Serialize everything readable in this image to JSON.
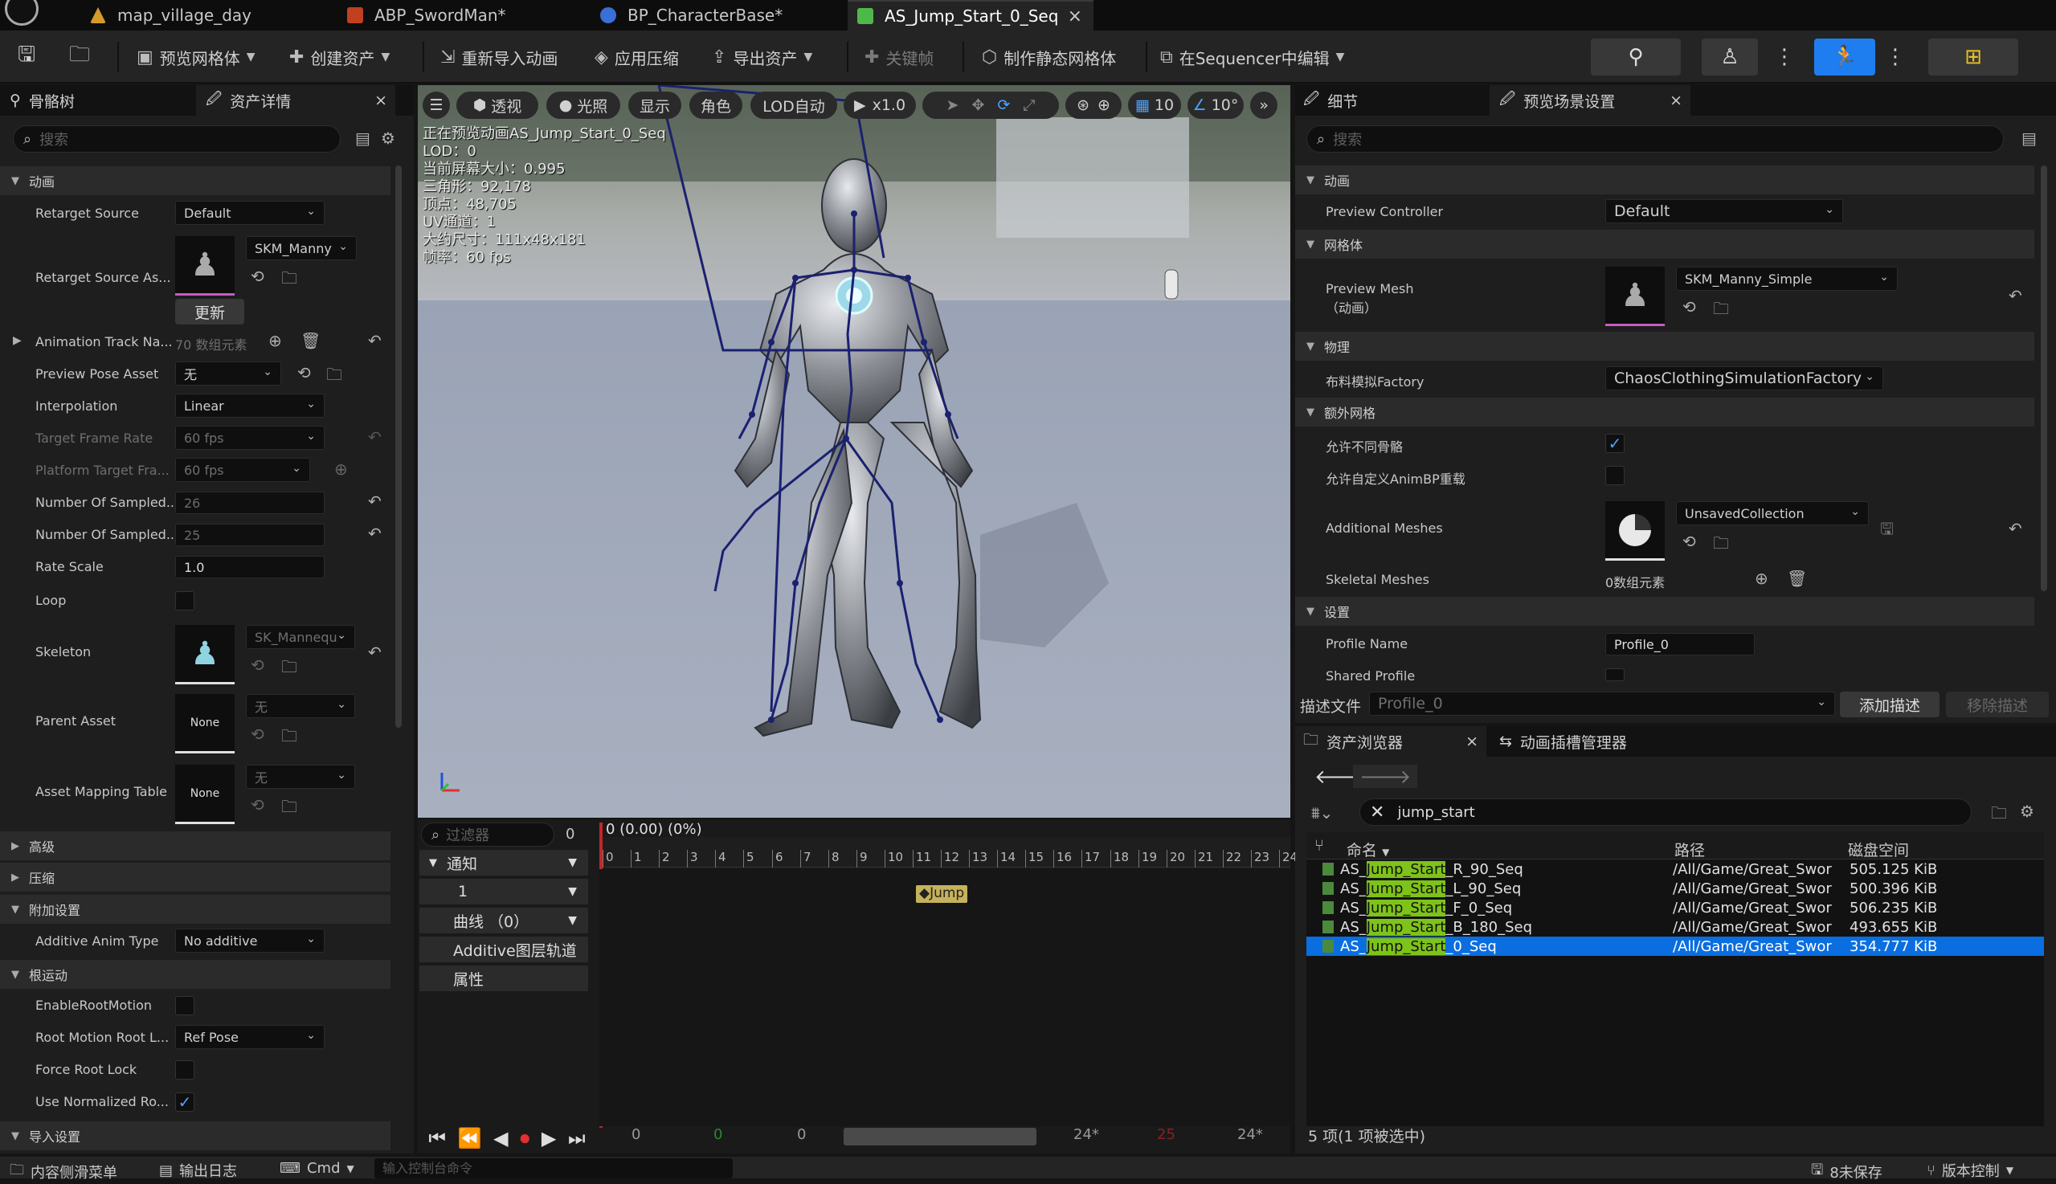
{
  "tabs": [
    {
      "label": "map_village_day",
      "icon": "map-icon",
      "color": "#d49a2a"
    },
    {
      "label": "ABP_SwordMan*",
      "icon": "anim-blueprint-icon",
      "color": "#c04020"
    },
    {
      "label": "BP_CharacterBase*",
      "icon": "blueprint-icon",
      "color": "#3a6fd6"
    },
    {
      "label": "AS_Jump_Start_0_Seq",
      "icon": "anim-sequence-icon",
      "color": "#4fb84a",
      "close": "×"
    }
  ],
  "toolbar": {
    "preview_mesh": "预览网格体",
    "create_asset": "创建资产",
    "reimport": "重新导入动画",
    "compression": "应用压缩",
    "export": "导出资产",
    "keyframe": "关键帧",
    "make_static_mesh": "制作静态网格体",
    "edit_in_sequencer": "在Sequencer中编辑"
  },
  "left_panel": {
    "tab_skeleton_tree": "骨骼树",
    "tab_asset_details": "资产详情",
    "close": "×",
    "search_placeholder": "搜索",
    "sections": {
      "animation": "动画",
      "advanced": "高级",
      "compression": "压缩",
      "additional_settings": "附加设置",
      "root_motion": "根运动",
      "import_settings": "导入设置"
    },
    "props": {
      "retarget_source": {
        "label": "Retarget Source",
        "value": "Default"
      },
      "retarget_source_asset": {
        "label": "Retarget Source As...",
        "value": "SKM_Manny",
        "update": "更新"
      },
      "animation_track_names": {
        "label": "Animation Track Na...",
        "value": "70 数组元素"
      },
      "preview_pose_asset": {
        "label": "Preview Pose Asset",
        "value": "无"
      },
      "interpolation": {
        "label": "Interpolation",
        "value": "Linear"
      },
      "target_frame_rate": {
        "label": "Target Frame Rate",
        "value": "60 fps"
      },
      "platform_target_frame_rate": {
        "label": "Platform Target Fra...",
        "value": "60 fps"
      },
      "number_sampled_keys": {
        "label": "Number Of Sampled...",
        "value": "26"
      },
      "number_sampled_frames": {
        "label": "Number Of Sampled...",
        "value": "25"
      },
      "rate_scale": {
        "label": "Rate Scale",
        "value": "1.0"
      },
      "loop": {
        "label": "Loop",
        "checked": false
      },
      "skeleton": {
        "label": "Skeleton",
        "value": "SK_Mannequ"
      },
      "parent_asset": {
        "label": "Parent Asset",
        "thumb": "None",
        "value": "无"
      },
      "asset_mapping_table": {
        "label": "Asset Mapping Table",
        "thumb": "None",
        "value": "无"
      },
      "additive_anim_type": {
        "label": "Additive Anim Type",
        "value": "No additive"
      },
      "enable_root_motion": {
        "label": "EnableRootMotion",
        "checked": false
      },
      "root_motion_root_lock": {
        "label": "Root Motion Root L...",
        "value": "Ref Pose"
      },
      "force_root_lock": {
        "label": "Force Root Lock",
        "checked": false
      },
      "use_normalized_root": {
        "label": "Use Normalized Ro...",
        "checked": true
      }
    }
  },
  "viewport": {
    "toolbar": {
      "perspective": "透视",
      "lit": "光照",
      "show": "显示",
      "character": "角色",
      "lod": "LOD自动",
      "play_rate": "x1.0",
      "grid_size": "10",
      "angle_snap": "10°"
    },
    "stats": [
      "正在预览动画AS_Jump_Start_0_Seq",
      "LOD：0",
      "当前屏幕大小：0.995",
      "三角形：92,178",
      "顶点：48,705",
      "UV通道：1",
      "大约尺寸：111x48x181",
      "帧率：60 fps"
    ]
  },
  "timeline": {
    "filter_placeholder": "过滤器",
    "filter_count": "0",
    "current_frame": "0 (0.00) (0%)",
    "tracks": [
      "通知",
      "1",
      "曲线 （0）",
      "Additive图层轨道",
      "属性"
    ],
    "ticks": [
      "0",
      "1",
      "2",
      "3",
      "4",
      "5",
      "6",
      "7",
      "8",
      "9",
      "10",
      "11",
      "12",
      "13",
      "14",
      "15",
      "16",
      "17",
      "18",
      "19",
      "20",
      "21",
      "22",
      "23",
      "24"
    ],
    "notify": "Jump",
    "bottom_numbers": [
      "0",
      "0",
      "0",
      "24*",
      "25",
      "24*"
    ]
  },
  "details": {
    "tab_details": "细节",
    "tab_preview_scene": "预览场景设置",
    "close": "×",
    "search_placeholder": "搜索",
    "sections": {
      "animation": "动画",
      "mesh": "网格体",
      "physics": "物理",
      "additional_meshes": "额外网格",
      "settings": "设置"
    },
    "preview_controller": {
      "label": "Preview Controller",
      "value": "Default"
    },
    "preview_mesh": {
      "label": "Preview Mesh",
      "sublabel": "（动画）",
      "value": "SKM_Manny_Simple"
    },
    "clothing_factory": {
      "label": "布料模拟Factory",
      "value": "ChaosClothingSimulationFactory"
    },
    "allow_different_skeletons": {
      "label": "允许不同骨骼",
      "checked": true
    },
    "allow_custom_animbp": {
      "label": "允许自定义AnimBP重载",
      "checked": false
    },
    "additional_meshes": {
      "label": "Additional Meshes",
      "value": "UnsavedCollection"
    },
    "skeletal_meshes": {
      "label": "Skeletal Meshes",
      "value": "0数组元素"
    },
    "profile_name": {
      "label": "Profile Name",
      "value": "Profile_0"
    },
    "shared_profile": {
      "label": "Shared Profile",
      "checked": false
    },
    "profile_file_label": "描述文件",
    "profile_file_value": "Profile_0",
    "add_profile": "添加描述",
    "remove_profile": "移除描述"
  },
  "content_browser": {
    "tab_browser": "资产浏览器",
    "tab_slot_manager": "动画插槽管理器",
    "close": "×",
    "search_value": "jump_start",
    "columns": {
      "name": "命名",
      "path": "路径",
      "disk": "磁盘空间"
    },
    "rows": [
      {
        "pre": "AS_",
        "hl": "Jump_Start",
        "post": "_R_90_Seq",
        "path": "/All/Game/Great_Swor",
        "size": "505.125 KiB",
        "selected": false
      },
      {
        "pre": "AS_",
        "hl": "Jump_Start",
        "post": "_L_90_Seq",
        "path": "/All/Game/Great_Swor",
        "size": "500.396 KiB",
        "selected": false
      },
      {
        "pre": "AS_",
        "hl": "Jump_Start",
        "post": "_F_0_Seq",
        "path": "/All/Game/Great_Swor",
        "size": "506.235 KiB",
        "selected": false
      },
      {
        "pre": "AS_",
        "hl": "Jump_Start",
        "post": "_B_180_Seq",
        "path": "/All/Game/Great_Swor",
        "size": "493.655 KiB",
        "selected": false
      },
      {
        "pre": "AS_",
        "hl": "Jump_Start",
        "post": "_0_Seq",
        "path": "/All/Game/Great_Swor",
        "size": "354.777 KiB",
        "selected": true
      }
    ],
    "status": "5 项(1 项被选中)"
  },
  "statusbar": {
    "content_drawer": "内容侧滑菜单",
    "output_log": "输出日志",
    "cmd": "Cmd",
    "console_placeholder": "输入控制台命令",
    "unsaved": "8未保存",
    "source_control": "版本控制"
  }
}
